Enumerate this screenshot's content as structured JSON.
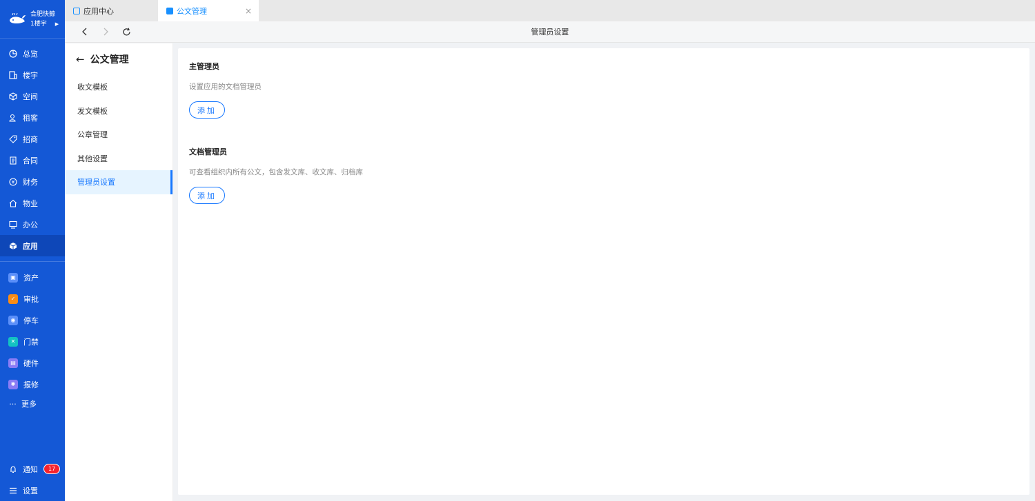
{
  "brand": {
    "name": "合肥快鲸",
    "building": "1楼宇"
  },
  "nav": {
    "items": [
      {
        "label": "总览",
        "icon": "dashboard-icon"
      },
      {
        "label": "楼宇",
        "icon": "building-icon"
      },
      {
        "label": "空间",
        "icon": "cube-icon"
      },
      {
        "label": "租客",
        "icon": "users-icon"
      },
      {
        "label": "招商",
        "icon": "tag-icon"
      },
      {
        "label": "合同",
        "icon": "document-icon"
      },
      {
        "label": "财务",
        "icon": "finance-icon"
      },
      {
        "label": "物业",
        "icon": "home-icon"
      },
      {
        "label": "办公",
        "icon": "monitor-icon"
      },
      {
        "label": "应用",
        "icon": "app-cube-icon"
      }
    ],
    "apps": [
      {
        "label": "资产",
        "color": "#5b8ff9"
      },
      {
        "label": "审批",
        "color": "#fa8c16"
      },
      {
        "label": "停车",
        "color": "#5b8ff9"
      },
      {
        "label": "门禁",
        "color": "#13c2c2"
      },
      {
        "label": "硬件",
        "color": "#8a7cf5"
      },
      {
        "label": "报修",
        "color": "#8a7cf5"
      }
    ],
    "more": "更多",
    "notify": "通知",
    "notify_count": "17",
    "settings": "设置"
  },
  "tabs": [
    {
      "label": "应用中心"
    },
    {
      "label": "公文管理"
    }
  ],
  "toolbar": {
    "title": "管理员设置"
  },
  "submenu": {
    "title": "公文管理",
    "items": [
      "收文模板",
      "发文模板",
      "公章管理",
      "其他设置",
      "管理员设置"
    ]
  },
  "main": {
    "primary": {
      "title": "主管理员",
      "desc": "设置应用的文档管理员",
      "button": "添加"
    },
    "doc": {
      "title": "文档管理员",
      "desc": "可查看组织内所有公文，包含发文库、收文库、归档库",
      "button": "添加"
    }
  },
  "colors": {
    "sidebar": "#1458d6",
    "accent": "#1677ff"
  }
}
